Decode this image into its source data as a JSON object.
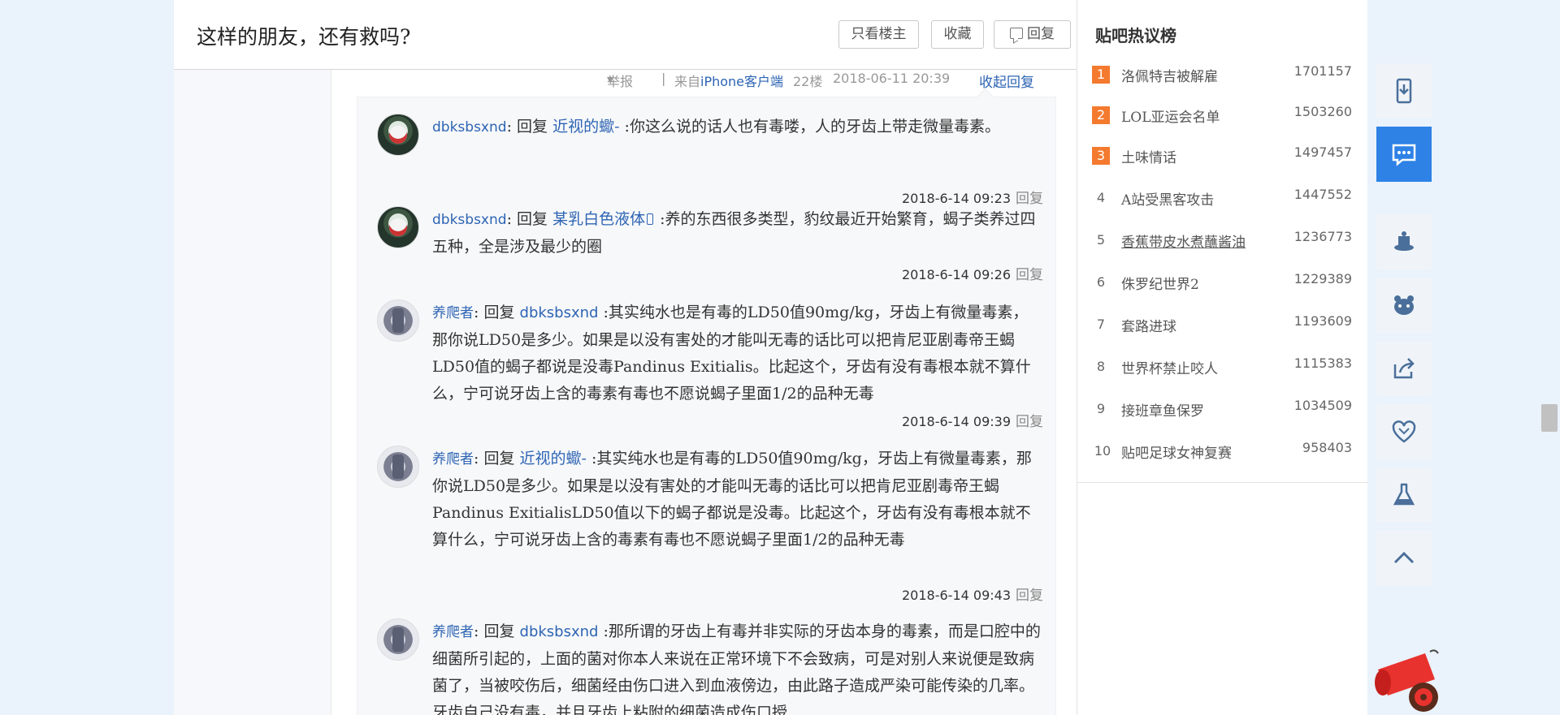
{
  "thread": {
    "title": "这样的朋友，还有救吗?",
    "btn_only_op": "只看楼主",
    "btn_favorite": "收藏",
    "btn_reply": "回复"
  },
  "post_meta": {
    "report": "举报",
    "separator": "|",
    "from_label": "来自",
    "client": "iPhone客户端",
    "floor": "22楼",
    "datetime": "2018-06-11 20:39",
    "collapse": "收起回复"
  },
  "replies": [
    {
      "author": "dbksbsxnd",
      "reply_word": "回复",
      "target": "近视的蠍-",
      "content": ":你这么说的话人也有毒喽，人的牙齿上带走微量毒素。",
      "time": "2018-6-14 09:23",
      "reply_link": "回复"
    },
    {
      "author": "dbksbsxnd",
      "reply_word": "回复",
      "target": "某乳白色液体",
      "content": ":养的东西很多类型，豹纹最近开始繁育，蝎子类养过四五种，全是涉及最少的圈",
      "time": "2018-6-14 09:26",
      "reply_link": "回复"
    },
    {
      "author": "养爬者",
      "reply_word": "回复",
      "target": "dbksbsxnd",
      "content": ":其实纯水也是有毒的LD50值90mg/kg，牙齿上有微量毒素，那你说LD50是多少。如果是以没有害处的才能叫无毒的话比可以把肯尼亚剧毒帝王蝎LD50值的蝎子都说是没毒Pandinus Exitialis。比起这个，牙齿有没有毒根本就不算什么，宁可说牙齿上含的毒素有毒也不愿说蝎子里面1/2的品种无毒",
      "time": "2018-6-14 09:39",
      "reply_link": "回复"
    },
    {
      "author": "养爬者",
      "reply_word": "回复",
      "target": "近视的蠍-",
      "content": ":其实纯水也是有毒的LD50值90mg/kg，牙齿上有微量毒素，那你说LD50是多少。如果是以没有害处的才能叫无毒的话比可以把肯尼亚剧毒帝王蝎Pandinus ExitialisLD50值以下的蝎子都说是没毒。比起这个，牙齿有没有毒根本就不算什么，宁可说牙齿上含的毒素有毒也不愿说蝎子里面1/2的品种无毒",
      "time": "2018-6-14 09:43",
      "reply_link": "回复"
    },
    {
      "author": "养爬者",
      "reply_word": "回复",
      "target": "dbksbsxnd",
      "content": ":那所谓的牙齿上有毒并非实际的牙齿本身的毒素，而是口腔中的细菌所引起的，上面的菌对你本人来说在正常环境下不会致病，可是对别人来说便是致病菌了，当被咬伤后，细菌经由伤口进入到血液傍边，由此路子造成严染可能传染的几率。牙齿自己没有毒，并且牙齿上粘附的细菌造成伤口授"
    }
  ],
  "hot_list": {
    "title": "贴吧热议榜",
    "items": [
      {
        "rank": "1",
        "name": "洛佩特吉被解雇",
        "count": "1701157"
      },
      {
        "rank": "2",
        "name": "LOL亚运会名单",
        "count": "1503260"
      },
      {
        "rank": "3",
        "name": "土味情话",
        "count": "1497457"
      },
      {
        "rank": "4",
        "name": "A站受黑客攻击",
        "count": "1447552"
      },
      {
        "rank": "5",
        "name": "香蕉带皮水煮蘸酱油",
        "count": "1236773"
      },
      {
        "rank": "6",
        "name": "侏罗纪世界2",
        "count": "1229389"
      },
      {
        "rank": "7",
        "name": "套路进球",
        "count": "1193609"
      },
      {
        "rank": "8",
        "name": "世界杯禁止咬人",
        "count": "1115383"
      },
      {
        "rank": "9",
        "name": "接班章鱼保罗",
        "count": "1034509"
      },
      {
        "rank": "10",
        "name": "贴吧足球女神复赛",
        "count": "958403"
      }
    ]
  },
  "side_tools": [
    "phone-download-icon",
    "message-icon",
    "magic-hat-icon",
    "bear-icon",
    "share-icon",
    "heart-icon",
    "flask-icon",
    "back-to-top-icon"
  ],
  "colors": {
    "link": "#2d64b3",
    "hot_rank": "#f47a2f",
    "active_tool": "#2e82e6",
    "page_bg": "#eaf2fb"
  }
}
